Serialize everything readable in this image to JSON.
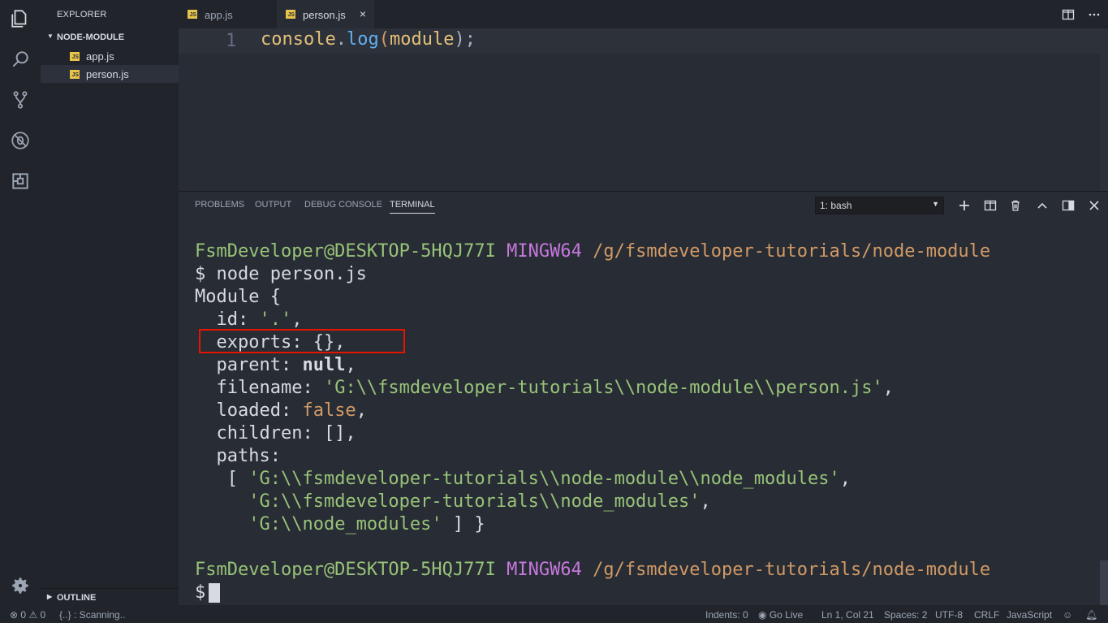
{
  "sidebar": {
    "title": "EXPLORER",
    "folder": "NODE-MODULE",
    "files": [
      "app.js",
      "person.js"
    ],
    "selected": "person.js",
    "outline": "OUTLINE",
    "js_badge": "JS"
  },
  "tabs": [
    {
      "label": "app.js",
      "active": false
    },
    {
      "label": "person.js",
      "active": true
    }
  ],
  "tab_close": "×",
  "editor": {
    "line_number": "1",
    "code_line": {
      "obj": "console",
      "dot": ".",
      "fn": "log",
      "open": "(",
      "arg": "module",
      "close": ");"
    }
  },
  "panel": {
    "tabs": [
      "PROBLEMS",
      "OUTPUT",
      "DEBUG CONSOLE",
      "TERMINAL"
    ],
    "active_tab": "TERMINAL",
    "terminal_select": "1: bash",
    "select_arrow": "▼"
  },
  "terminal": {
    "prompt_user": "FsmDeveloper@DESKTOP-5HQJ77I",
    "prompt_env": "MINGW64",
    "prompt_path": "/g/fsmdeveloper-tutorials/node-module",
    "dollar": "$",
    "command": "node person.js",
    "out": {
      "l1": "Module {",
      "id_key": "  id: ",
      "id_val": "'.'",
      "id_end": ",",
      "exports": "  exports: {},",
      "parent_key": "  parent: ",
      "parent_val": "null",
      "parent_end": ",",
      "filename_key": "  filename: ",
      "filename_val": "'G:\\\\fsmdeveloper-tutorials\\\\node-module\\\\person.js'",
      "filename_end": ",",
      "loaded_key": "  loaded: ",
      "loaded_val": "false",
      "loaded_end": ",",
      "children": "  children: [],",
      "paths": "  paths:",
      "p1_pre": "   [ ",
      "p1": "'G:\\\\fsmdeveloper-tutorials\\\\node-module\\\\node_modules'",
      "p1_end": ",",
      "p2_pre": "     ",
      "p2": "'G:\\\\fsmdeveloper-tutorials\\\\node_modules'",
      "p2_end": ",",
      "p3_pre": "     ",
      "p3": "'G:\\\\node_modules'",
      "p3_end": " ] }"
    }
  },
  "status": {
    "errors": "0",
    "warnings": "0",
    "scanning": "{..} : Scanning..",
    "indents": "Indents: 0",
    "golive": "Go Live",
    "position": "Ln 1, Col 21",
    "spaces": "Spaces: 2",
    "encoding": "UTF-8",
    "eol": "CRLF",
    "language": "JavaScript"
  },
  "colors": {
    "highlight_box": "#e51400",
    "accent": "#e8c44a"
  }
}
